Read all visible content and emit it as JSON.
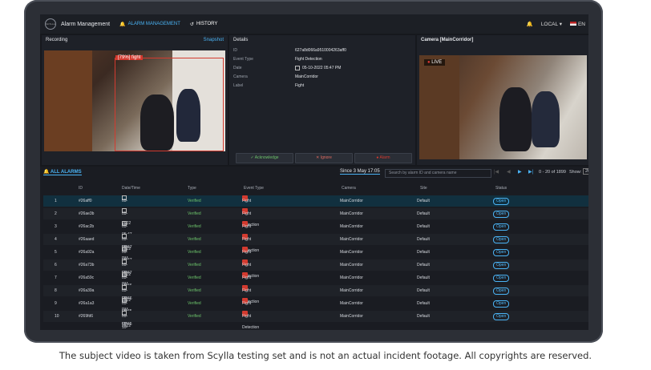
{
  "app": {
    "title": "Alarm Management",
    "logo_text": "SCYLLA"
  },
  "nav": {
    "alarm_tab": "ALARM MANAGEMENT",
    "history_tab": "HISTORY"
  },
  "topright": {
    "location": "LOCAL",
    "lang": "EN"
  },
  "recording": {
    "title": "Recording",
    "snapshot": "Snapshot",
    "overlay": "[79%] fight"
  },
  "details": {
    "title": "Details",
    "rows": [
      {
        "k": "ID",
        "v": "627a8d066a9510004263aff0"
      },
      {
        "k": "Event Type",
        "v": "Fight Detection"
      },
      {
        "k": "Date",
        "v": "05-10-2022 05:47 PM"
      },
      {
        "k": "Camera",
        "v": "MainCorridor"
      },
      {
        "k": "Label",
        "v": "Fight"
      }
    ],
    "acknowledge": "Acknowledge",
    "ignore": "Ignore",
    "alarm": "Alarm"
  },
  "camera": {
    "title": "Camera [MainCorridor]",
    "live": "LIVE"
  },
  "alarms": {
    "tab": "ALL ALARMS",
    "since": "Since 3 May 17:05",
    "search_placeholder": "Search by alarm ID and camera name",
    "range": "0 - 20 of 1899",
    "show_label": "Show:",
    "show_value": "20",
    "headers": {
      "id": "ID",
      "date": "Date/Time",
      "type": "Type",
      "event": "Event Type",
      "camera": "Camera",
      "site": "Site",
      "status": "Status"
    },
    "rows": [
      {
        "n": "1",
        "id": "#26aff0",
        "date": "05-10-2022 05:47 PM",
        "type": "Verified",
        "event": "Fight Detection",
        "camera": "MainCorridor",
        "site": "Default",
        "status": "Open"
      },
      {
        "n": "2",
        "id": "#26ae3b",
        "date": "05-10-2022 05:47 PM",
        "type": "Verified",
        "event": "Fight Detection",
        "camera": "MainCorridor",
        "site": "Default",
        "status": "Open"
      },
      {
        "n": "3",
        "id": "#26ac2b",
        "date": "05-10-2022 05:47 PM",
        "type": "Verified",
        "event": "Fight Detection",
        "camera": "MainCorridor",
        "site": "Default",
        "status": "Open"
      },
      {
        "n": "4",
        "id": "#26aaed",
        "date": "05-10-2022 05:47 PM",
        "type": "Verified",
        "event": "Fight Detection",
        "camera": "MainCorridor",
        "site": "Default",
        "status": "Open"
      },
      {
        "n": "5",
        "id": "#26a92a",
        "date": "05-10-2022 05:46 PM",
        "type": "Verified",
        "event": "Fight Detection",
        "camera": "MainCorridor",
        "site": "Default",
        "status": "Open"
      },
      {
        "n": "6",
        "id": "#26a73b",
        "date": "05-10-2022 05:46 PM",
        "type": "Verified",
        "event": "Fight Detection",
        "camera": "MainCorridor",
        "site": "Default",
        "status": "Open"
      },
      {
        "n": "7",
        "id": "#26a59c",
        "date": "05-10-2022 05:45 PM",
        "type": "Verified",
        "event": "Fight Detection",
        "camera": "MainCorridor",
        "site": "Default",
        "status": "Open"
      },
      {
        "n": "8",
        "id": "#26a39a",
        "date": "05-10-2022 05:45 PM",
        "type": "Verified",
        "event": "Fight Detection",
        "camera": "MainCorridor",
        "site": "Default",
        "status": "Open"
      },
      {
        "n": "9",
        "id": "#26a1a3",
        "date": "05-10-2022 05:45 PM",
        "type": "Verified",
        "event": "Fight Detection",
        "camera": "MainCorridor",
        "site": "Default",
        "status": "Open"
      },
      {
        "n": "10",
        "id": "#269fd6",
        "date": "05-10-2022 05:44 PM",
        "type": "Verified",
        "event": "Fight Detection",
        "camera": "MainCorridor",
        "site": "Default",
        "status": "Open"
      }
    ]
  },
  "caption": "The subject video is taken from Scylla testing set and is not an actual incident footage. All copyrights are reserved.",
  "colors": {
    "accent": "#4ab3f4",
    "verified": "#6cc26a",
    "alarm_red": "#d33a2f",
    "live_red": "#e53935"
  }
}
